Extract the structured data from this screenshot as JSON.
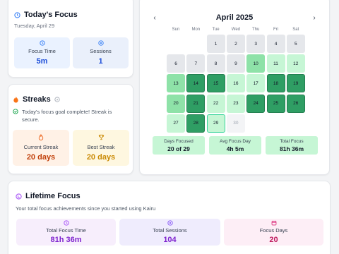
{
  "today": {
    "title": "Today's Focus",
    "date": "Tuesday, April 29",
    "focus_time_label": "Focus Time",
    "focus_time_value": "5m",
    "sessions_label": "Sessions",
    "sessions_value": "1"
  },
  "streaks": {
    "title": "Streaks",
    "message": "Today's focus goal complete! Streak is secure.",
    "current_label": "Current Streak",
    "current_value": "20 days",
    "best_label": "Best Streak",
    "best_value": "20 days"
  },
  "calendar": {
    "prev": "‹",
    "next": "›",
    "month": "April 2025",
    "weekdays": [
      "Sun",
      "Mon",
      "Tue",
      "Wed",
      "Thu",
      "Fri",
      "Sat"
    ],
    "first_weekday": 2,
    "intensity_levels": {
      "none": "#e5e7eb",
      "low": "#c6f6d5",
      "mid": "#8ee2a8",
      "high": "#2f9e64",
      "future": "#f3f4f6"
    },
    "days": [
      {
        "d": "1",
        "level": "none"
      },
      {
        "d": "2",
        "level": "none"
      },
      {
        "d": "3",
        "level": "none"
      },
      {
        "d": "4",
        "level": "none"
      },
      {
        "d": "5",
        "level": "none"
      },
      {
        "d": "6",
        "level": "none"
      },
      {
        "d": "7",
        "level": "none"
      },
      {
        "d": "8",
        "level": "none"
      },
      {
        "d": "9",
        "level": "none"
      },
      {
        "d": "10",
        "level": "mid"
      },
      {
        "d": "11",
        "level": "low"
      },
      {
        "d": "12",
        "level": "low"
      },
      {
        "d": "13",
        "level": "mid"
      },
      {
        "d": "14",
        "level": "high"
      },
      {
        "d": "15",
        "level": "high"
      },
      {
        "d": "16",
        "level": "low"
      },
      {
        "d": "17",
        "level": "low"
      },
      {
        "d": "18",
        "level": "high"
      },
      {
        "d": "19",
        "level": "high"
      },
      {
        "d": "20",
        "level": "mid"
      },
      {
        "d": "21",
        "level": "high"
      },
      {
        "d": "22",
        "level": "low"
      },
      {
        "d": "23",
        "level": "low"
      },
      {
        "d": "24",
        "level": "high"
      },
      {
        "d": "25",
        "level": "high"
      },
      {
        "d": "26",
        "level": "high"
      },
      {
        "d": "27",
        "level": "low"
      },
      {
        "d": "28",
        "level": "high"
      },
      {
        "d": "29",
        "level": "low",
        "today": true
      },
      {
        "d": "30",
        "level": "future"
      }
    ],
    "days_focused_label": "Days Focused",
    "days_focused_value": "20 of 29",
    "avg_label": "Avg Focus Day",
    "avg_value": "4h 5m",
    "total_label": "Total Focus",
    "total_value": "81h 36m"
  },
  "lifetime": {
    "title": "Lifetime Focus",
    "subtitle": "Your total focus achievements since you started using Kairu",
    "time_label": "Total Focus Time",
    "time_value": "81h 36m",
    "sessions_label": "Total Sessions",
    "sessions_value": "104",
    "days_label": "Focus Days",
    "days_value": "20"
  },
  "colors": {
    "blue": "#1d4ed8",
    "orange": "#c2410c",
    "amber": "#ca8a04",
    "purple": "#7e22ce",
    "pink": "#be185d",
    "green_today": "#16a34a"
  }
}
